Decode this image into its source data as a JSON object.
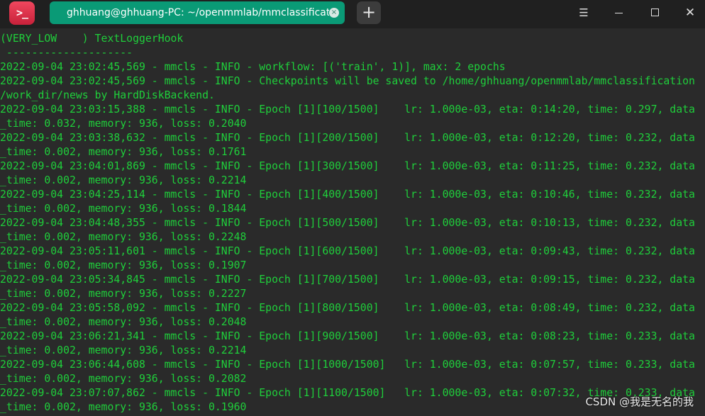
{
  "app": {
    "logo_glyph": ">_",
    "accent_color": "#0a9a76",
    "logo_color": "#e0334e"
  },
  "tab": {
    "title": "ghhuang@ghhuang-PC: ~/openmmlab/mmclassification",
    "close_glyph": "×"
  },
  "toolbar": {
    "new_tab_glyph": "+",
    "menu_glyph": "☰",
    "minimize_icon": "minimize-icon",
    "maximize_icon": "maximize-icon",
    "close_glyph": "✕"
  },
  "terminal": {
    "text_color": "#1fcf3b",
    "lines": [
      "(VERY_LOW    ) TextLoggerHook",
      " --------------------",
      "2022-09-04 23:02:45,569 - mmcls - INFO - workflow: [('train', 1)], max: 2 epochs",
      "2022-09-04 23:02:45,569 - mmcls - INFO - Checkpoints will be saved to /home/ghhuang/openmmlab/mmclassification",
      "/work_dir/news by HardDiskBackend.",
      "2022-09-04 23:03:15,388 - mmcls - INFO - Epoch [1][100/1500]    lr: 1.000e-03, eta: 0:14:20, time: 0.297, data",
      "_time: 0.032, memory: 936, loss: 0.2040",
      "2022-09-04 23:03:38,632 - mmcls - INFO - Epoch [1][200/1500]    lr: 1.000e-03, eta: 0:12:20, time: 0.232, data",
      "_time: 0.002, memory: 936, loss: 0.1761",
      "2022-09-04 23:04:01,869 - mmcls - INFO - Epoch [1][300/1500]    lr: 1.000e-03, eta: 0:11:25, time: 0.232, data",
      "_time: 0.002, memory: 936, loss: 0.2214",
      "2022-09-04 23:04:25,114 - mmcls - INFO - Epoch [1][400/1500]    lr: 1.000e-03, eta: 0:10:46, time: 0.232, data",
      "_time: 0.002, memory: 936, loss: 0.1844",
      "2022-09-04 23:04:48,355 - mmcls - INFO - Epoch [1][500/1500]    lr: 1.000e-03, eta: 0:10:13, time: 0.232, data",
      "_time: 0.002, memory: 936, loss: 0.2248",
      "2022-09-04 23:05:11,601 - mmcls - INFO - Epoch [1][600/1500]    lr: 1.000e-03, eta: 0:09:43, time: 0.232, data",
      "_time: 0.002, memory: 936, loss: 0.1907",
      "2022-09-04 23:05:34,845 - mmcls - INFO - Epoch [1][700/1500]    lr: 1.000e-03, eta: 0:09:15, time: 0.232, data",
      "_time: 0.002, memory: 936, loss: 0.2227",
      "2022-09-04 23:05:58,092 - mmcls - INFO - Epoch [1][800/1500]    lr: 1.000e-03, eta: 0:08:49, time: 0.232, data",
      "_time: 0.002, memory: 936, loss: 0.2048",
      "2022-09-04 23:06:21,341 - mmcls - INFO - Epoch [1][900/1500]    lr: 1.000e-03, eta: 0:08:23, time: 0.233, data",
      "_time: 0.002, memory: 936, loss: 0.2214",
      "2022-09-04 23:06:44,608 - mmcls - INFO - Epoch [1][1000/1500]   lr: 1.000e-03, eta: 0:07:57, time: 0.233, data",
      "_time: 0.002, memory: 936, loss: 0.2082",
      "2022-09-04 23:07:07,862 - mmcls - INFO - Epoch [1][1100/1500]   lr: 1.000e-03, eta: 0:07:32, time: 0.233, data",
      "_time: 0.002, memory: 936, loss: 0.1960"
    ]
  },
  "watermark": {
    "text": "CSDN @我是无名的我"
  }
}
